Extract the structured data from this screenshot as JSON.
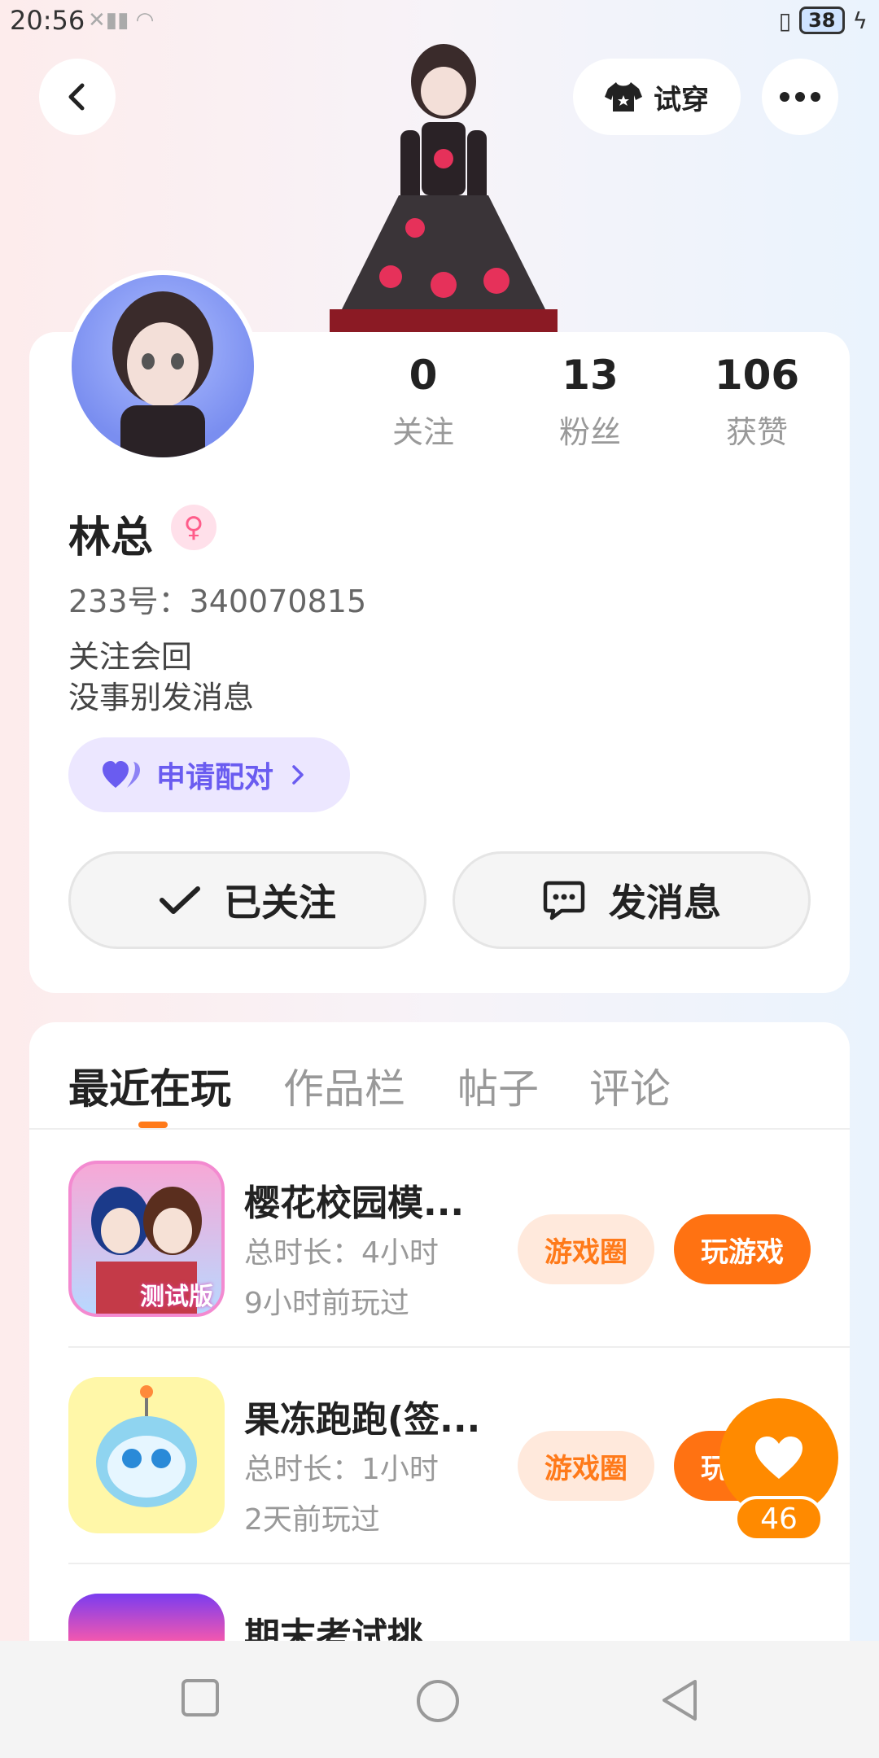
{
  "status_bar": {
    "time": "20:56",
    "battery": "38"
  },
  "top_bar": {
    "tryon_label": "试穿"
  },
  "profile": {
    "stats": [
      {
        "value": "0",
        "label": "关注"
      },
      {
        "value": "13",
        "label": "粉丝"
      },
      {
        "value": "106",
        "label": "获赞"
      }
    ],
    "name": "林总",
    "gender_icon": "female-icon",
    "id_text": "233号：340070815",
    "bio_line1": "关注会回",
    "bio_line2": "没事别发消息",
    "pair_label": "申请配对",
    "followed_label": "已关注",
    "message_label": "发消息"
  },
  "tabs": [
    {
      "label": "最近在玩",
      "active": true
    },
    {
      "label": "作品栏",
      "active": false
    },
    {
      "label": "帖子",
      "active": false
    },
    {
      "label": "评论",
      "active": false
    }
  ],
  "games": [
    {
      "title": "樱花校园模...",
      "duration": "总时长：4小时",
      "last_played": "9小时前玩过",
      "circle_label": "游戏圈",
      "play_label": "玩游戏",
      "icon_badge": "测试版"
    },
    {
      "title": "果冻跑跑(签...",
      "duration": "总时长：1小时",
      "last_played": "2天前玩过",
      "circle_label": "游戏圈",
      "play_label": "玩游戏"
    },
    {
      "title": "期末考试挑"
    }
  ],
  "like_count": "46",
  "colors": {
    "accent": "#ff7212",
    "pair": "#6a5cf0",
    "like": "#ff8a00"
  }
}
